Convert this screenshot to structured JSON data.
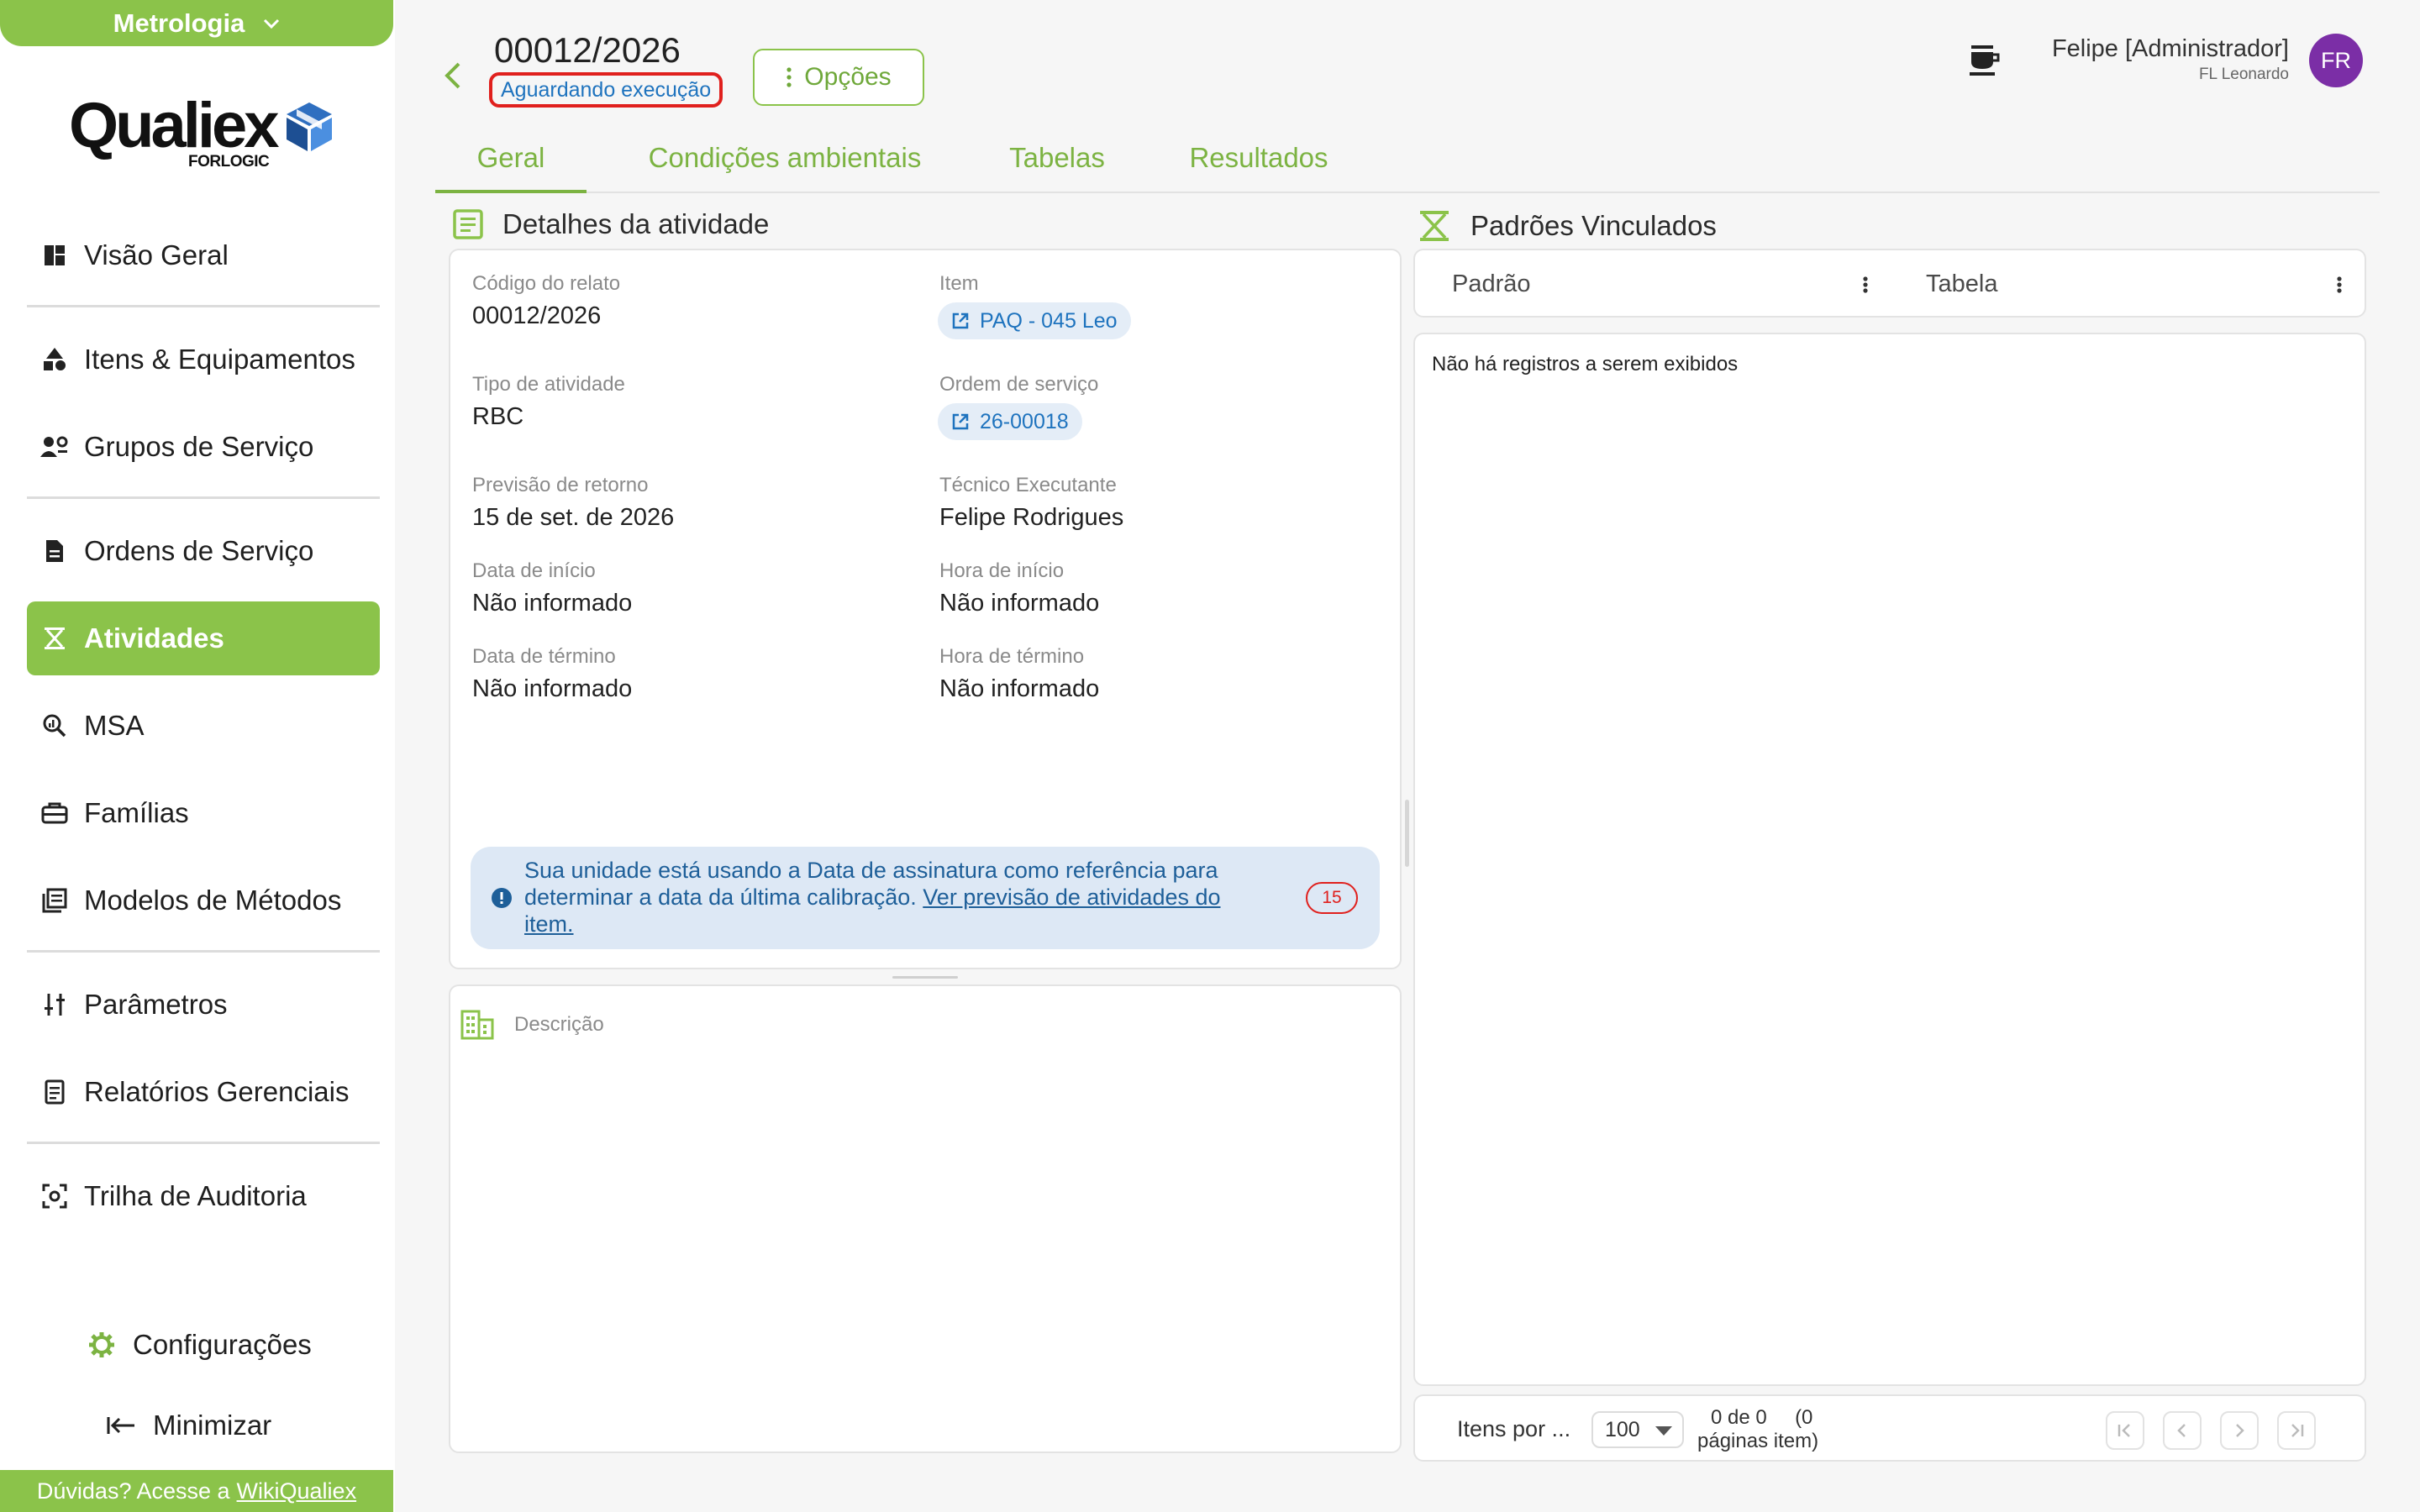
{
  "sidebar": {
    "module": "Metrologia",
    "logo": {
      "word": "Qualiex",
      "sub": "FORLOGIC"
    },
    "items": [
      {
        "label": "Visão Geral",
        "icon": "dashboard-icon"
      },
      {
        "label": "Itens & Equipamentos",
        "icon": "shapes-icon"
      },
      {
        "label": "Grupos de Serviço",
        "icon": "group-settings-icon"
      },
      {
        "label": "Ordens de Serviço",
        "icon": "document-icon"
      },
      {
        "label": "Atividades",
        "icon": "hourglass-icon",
        "active": true
      },
      {
        "label": "MSA",
        "icon": "zoom-analytics-icon"
      },
      {
        "label": "Famílias",
        "icon": "toolbox-icon"
      },
      {
        "label": "Modelos de Métodos",
        "icon": "library-books-icon"
      },
      {
        "label": "Parâmetros",
        "icon": "sliders-icon"
      },
      {
        "label": "Relatórios Gerenciais",
        "icon": "report-icon"
      },
      {
        "label": "Trilha de Auditoria",
        "icon": "audit-scan-icon"
      }
    ],
    "settings_label": "Configurações",
    "minimize_label": "Minimizar",
    "help_text": "Dúvidas? Acesse a",
    "help_link": "WikiQualiex"
  },
  "header": {
    "title": "00012/2026",
    "status": "Aguardando execução",
    "options_label": "Opções",
    "user_name": "Felipe [Administrador]",
    "user_org": "FL Leonardo",
    "avatar_initials": "FR"
  },
  "tabs": [
    "Geral",
    "Condições ambientais",
    "Tabelas",
    "Resultados"
  ],
  "details": {
    "heading": "Detalhes da atividade",
    "fields": {
      "codigo_label": "Código do relato",
      "codigo_value": "00012/2026",
      "item_label": "Item",
      "item_value": "PAQ - 045 Leo",
      "tipo_label": "Tipo de atividade",
      "tipo_value": "RBC",
      "ordem_label": "Ordem de serviço",
      "ordem_value": "26-00018",
      "previsao_label": "Previsão de retorno",
      "previsao_value": "15 de set. de 2026",
      "tecnico_label": "Técnico Executante",
      "tecnico_value": "Felipe Rodrigues",
      "data_inicio_label": "Data de início",
      "data_inicio_value": "Não informado",
      "hora_inicio_label": "Hora de início",
      "hora_inicio_value": "Não informado",
      "data_termino_label": "Data de término",
      "data_termino_value": "Não informado",
      "hora_termino_label": "Hora de término",
      "hora_termino_value": "Não informado"
    },
    "info_text": "Sua unidade está usando a Data de assinatura como referência para determinar a data da última calibração.",
    "info_link": "Ver previsão de atividades do item.",
    "info_count": "15",
    "description_placeholder": "Descrição"
  },
  "standards": {
    "heading": "Padrões Vinculados",
    "columns": [
      "Padrão",
      "Tabela"
    ],
    "empty_message": "Não há registros a serem exibidos",
    "pager": {
      "items_per_page_label": "Itens por ...",
      "page_size": "100",
      "count_line1": "0 de 0     (0",
      "count_line2": "páginas item)"
    }
  },
  "colors": {
    "accent": "#8bc34a",
    "status_border": "#e0201d",
    "link": "#1e73be",
    "avatar": "#7b2ea6"
  }
}
